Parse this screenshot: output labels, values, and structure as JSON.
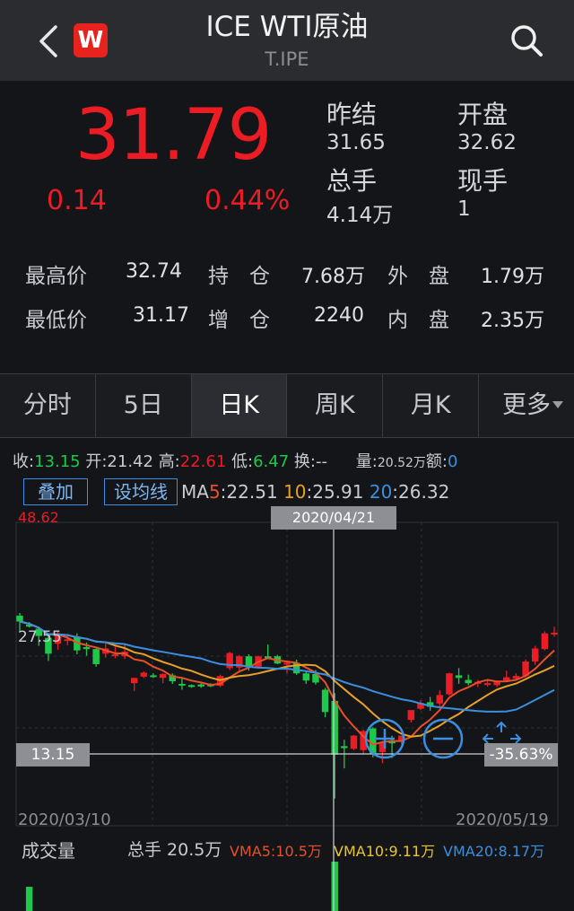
{
  "header": {
    "title": "ICE WTI原油",
    "subtitle": "T.IPE",
    "logo_letter": "W"
  },
  "quote": {
    "price": "31.79",
    "change": "0.14",
    "change_pct": "0.44%",
    "prev_settle_label": "昨结",
    "prev_settle": "31.65",
    "open_label": "开盘",
    "open": "32.62",
    "total_volume_label": "总手",
    "total_volume": "4.14万",
    "current_volume_label": "现手",
    "current_volume": "1",
    "high_label": "最高价",
    "high": "32.74",
    "low_label": "最低价",
    "low": "31.17",
    "open_interest_label": "持　仓",
    "open_interest": "7.68万",
    "oi_change_label": "增　仓",
    "oi_change": "2240",
    "outer_label": "外　盘",
    "outer": "1.79万",
    "inner_label": "内　盘",
    "inner": "2.35万"
  },
  "tabs": [
    {
      "label": "分时"
    },
    {
      "label": "5日"
    },
    {
      "label": "日K"
    },
    {
      "label": "周K"
    },
    {
      "label": "月K"
    },
    {
      "label": "更多"
    }
  ],
  "ohlc": {
    "close_label": "收:",
    "close": "13.15",
    "open_label": "开:",
    "open": "21.42",
    "high_label": "高:",
    "high": "22.61",
    "low_label": "低:",
    "low": "6.47",
    "turnover_label": "换:",
    "turnover": "--",
    "volume_label": "量:",
    "volume": "20.52万",
    "amount_label": "额:",
    "amount": "0"
  },
  "chart_controls": {
    "overlay_label": "叠加",
    "set_ma_label": "设均线",
    "ma_label": "MA",
    "ma5_key": "5",
    "ma5": ":22.51",
    "ma10_key": "10",
    "ma10": ":25.91",
    "ma20_key": "20",
    "ma20": ":26.32"
  },
  "chart_labels": {
    "y_max": "48.62",
    "y_mid": "27.55",
    "cursor_date": "2020/04/21",
    "cursor_price": "13.15",
    "cursor_pct": "-35.63%",
    "start_date": "2020/03/10",
    "end_date": "2020/05/19"
  },
  "volume": {
    "label": "成交量",
    "total": "总手 20.5万",
    "vma5": "VMA5:10.5万",
    "vma10": "VMA10:9.11万",
    "vma20": "VMA20:8.17万"
  },
  "colors": {
    "up": "#ec1c24",
    "down": "#1ec84a",
    "ma5": "#e8502a",
    "ma10": "#e9a028",
    "ma20": "#3b8fe0"
  },
  "chart_data": {
    "type": "candlestick",
    "x_start": "2020/03/10",
    "x_end": "2020/05/19",
    "y_range": [
      6.47,
      48.62
    ],
    "candles": [
      {
        "o": 34.4,
        "h": 34.8,
        "c": 33.5,
        "l": 32.0
      },
      {
        "o": 33.0,
        "h": 33.4,
        "c": 32.8,
        "l": 32.6
      },
      {
        "o": 32.4,
        "h": 32.6,
        "c": 31.3,
        "l": 29.8
      },
      {
        "o": 31.0,
        "h": 31.6,
        "c": 28.6,
        "l": 27.5
      },
      {
        "o": 30.1,
        "h": 32.1,
        "c": 31.6,
        "l": 29.2
      },
      {
        "o": 30.7,
        "h": 31.6,
        "c": 30.8,
        "l": 29.9
      },
      {
        "o": 31.2,
        "h": 31.7,
        "c": 29.1,
        "l": 28.5
      },
      {
        "o": 29.6,
        "h": 30.3,
        "c": 29.3,
        "l": 28.3
      },
      {
        "o": 29.3,
        "h": 29.4,
        "c": 27.0,
        "l": 26.6
      },
      {
        "o": 28.6,
        "h": 30.2,
        "c": 29.4,
        "l": 28.0
      },
      {
        "o": 28.4,
        "h": 29.8,
        "c": 28.5,
        "l": 27.9
      },
      {
        "o": 28.2,
        "h": 30.1,
        "c": 28.9,
        "l": 27.8
      },
      {
        "o": 24.1,
        "h": 24.9,
        "c": 24.9,
        "l": 22.9
      },
      {
        "o": 25.1,
        "h": 25.9,
        "c": 25.7,
        "l": 24.9
      },
      {
        "o": 25.3,
        "h": 25.6,
        "c": 25.1,
        "l": 24.9
      },
      {
        "o": 24.9,
        "h": 25.6,
        "c": 25.5,
        "l": 24.1
      },
      {
        "o": 25.3,
        "h": 25.6,
        "c": 24.4,
        "l": 24.0
      },
      {
        "o": 24.0,
        "h": 24.8,
        "c": 23.9,
        "l": 23.1
      },
      {
        "o": 23.8,
        "h": 23.9,
        "c": 23.6,
        "l": 23.4
      },
      {
        "o": 23.9,
        "h": 24.1,
        "c": 23.6,
        "l": 23.4
      },
      {
        "o": 23.9,
        "h": 24.1,
        "c": 23.7,
        "l": 23.5
      },
      {
        "o": 23.7,
        "h": 25.4,
        "c": 25.2,
        "l": 23.5
      },
      {
        "o": 26.4,
        "h": 28.9,
        "c": 28.7,
        "l": 26.1
      },
      {
        "o": 26.5,
        "h": 28.4,
        "c": 28.2,
        "l": 26.0
      },
      {
        "o": 28.2,
        "h": 28.5,
        "c": 26.5,
        "l": 26.0
      },
      {
        "o": 26.6,
        "h": 28.3,
        "c": 28.2,
        "l": 26.4
      },
      {
        "o": 28.2,
        "h": 30.0,
        "c": 28.0,
        "l": 27.8
      },
      {
        "o": 28.2,
        "h": 28.4,
        "c": 27.1,
        "l": 27.0
      },
      {
        "o": 27.0,
        "h": 27.6,
        "c": 27.2,
        "l": 25.6
      },
      {
        "o": 27.2,
        "h": 27.7,
        "c": 25.6,
        "l": 25.4
      },
      {
        "o": 25.6,
        "h": 26.0,
        "c": 24.5,
        "l": 24.0
      },
      {
        "o": 25.5,
        "h": 26.1,
        "c": 24.2,
        "l": 23.9
      },
      {
        "o": 23.1,
        "h": 23.4,
        "c": 19.7,
        "l": 18.9
      },
      {
        "o": 21.4,
        "h": 22.6,
        "c": 13.2,
        "l": 6.5
      },
      {
        "o": 14.5,
        "h": 15.5,
        "c": 14.2,
        "l": 11.1
      },
      {
        "o": 14.1,
        "h": 16.2,
        "c": 16.1,
        "l": 13.9
      },
      {
        "o": 13.9,
        "h": 17.0,
        "c": 16.8,
        "l": 13.2
      },
      {
        "o": 17.2,
        "h": 17.4,
        "c": 13.4,
        "l": 12.8
      },
      {
        "o": 13.6,
        "h": 15.3,
        "c": 15.1,
        "l": 11.9
      },
      {
        "o": 15.2,
        "h": 16.1,
        "c": 15.0,
        "l": 12.7
      },
      {
        "o": 15.3,
        "h": 16.1,
        "c": 16.1,
        "l": 14.8
      },
      {
        "o": 18.5,
        "h": 20.0,
        "c": 20.0,
        "l": 18.1
      },
      {
        "o": 20.2,
        "h": 21.5,
        "c": 21.1,
        "l": 20.0
      },
      {
        "o": 21.2,
        "h": 22.0,
        "c": 20.5,
        "l": 19.9
      },
      {
        "o": 21.0,
        "h": 23.0,
        "c": 22.3,
        "l": 20.5
      },
      {
        "o": 22.4,
        "h": 25.7,
        "c": 25.6,
        "l": 22.2
      },
      {
        "o": 25.3,
        "h": 26.4,
        "c": 24.9,
        "l": 24.0
      },
      {
        "o": 24.6,
        "h": 25.4,
        "c": 24.1,
        "l": 23.8
      },
      {
        "o": 24.0,
        "h": 24.6,
        "c": 24.3,
        "l": 23.5
      },
      {
        "o": 23.9,
        "h": 24.5,
        "c": 24.1,
        "l": 23.6
      },
      {
        "o": 23.8,
        "h": 24.4,
        "c": 24.4,
        "l": 23.5
      },
      {
        "o": 24.5,
        "h": 26.0,
        "c": 25.0,
        "l": 24.3
      },
      {
        "o": 24.8,
        "h": 25.6,
        "c": 25.2,
        "l": 24.5
      },
      {
        "o": 25.2,
        "h": 27.7,
        "c": 27.4,
        "l": 25.0
      },
      {
        "o": 27.4,
        "h": 29.8,
        "c": 29.4,
        "l": 26.9
      },
      {
        "o": 29.3,
        "h": 32.0,
        "c": 31.7,
        "l": 29.1
      },
      {
        "o": 31.6,
        "h": 32.7,
        "c": 31.8,
        "l": 31.2
      }
    ]
  }
}
